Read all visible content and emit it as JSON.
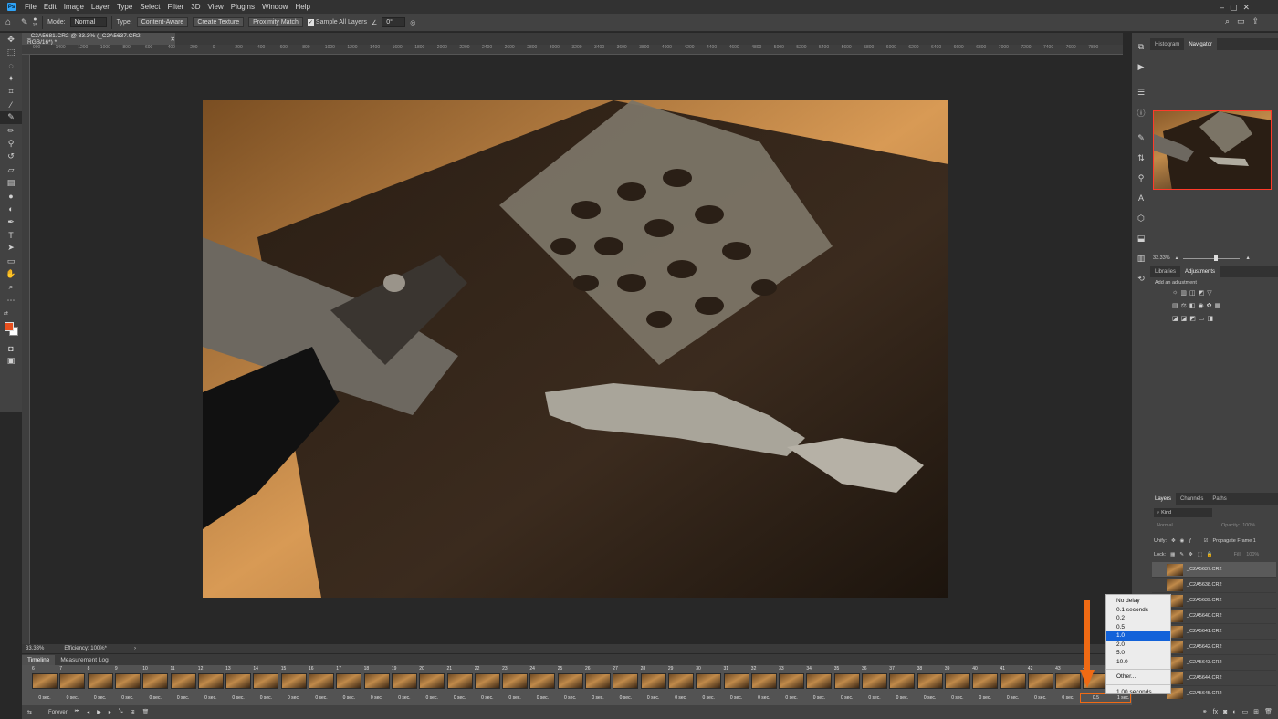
{
  "menubar": {
    "logo": "Ps",
    "items": [
      "File",
      "Edit",
      "Image",
      "Layer",
      "Type",
      "Select",
      "Filter",
      "3D",
      "View",
      "Plugins",
      "Window",
      "Help"
    ]
  },
  "options": {
    "brush_size": "15",
    "mode_label": "Mode:",
    "mode_value": "Normal",
    "type_label": "Type:",
    "type_content_aware": "Content-Aware",
    "type_create_texture": "Create Texture",
    "type_proximity": "Proximity Match",
    "sample_all": "Sample All Layers",
    "angle": "0°"
  },
  "document": {
    "tab_title": "_C2A5681.CR2 @ 33.3% (_C2A5637.CR2, RGB/16*) *",
    "zoom": "33.33%",
    "efficiency": "Efficiency: 100%*"
  },
  "ruler": {
    "h": [
      "900",
      "1400",
      "1200",
      "1000",
      "800",
      "600",
      "400",
      "200",
      "0",
      "200",
      "400",
      "600",
      "800",
      "1000",
      "1200",
      "1400",
      "1600",
      "1800",
      "2000",
      "2200",
      "2400",
      "2600",
      "2800",
      "3000",
      "3200",
      "3400",
      "3600",
      "3800",
      "4000",
      "4200",
      "4400",
      "4600",
      "4800",
      "5000",
      "5200",
      "5400",
      "5600",
      "5800",
      "6000",
      "6200",
      "6400",
      "6600",
      "6800",
      "7000",
      "7200",
      "7400",
      "7600",
      "7800"
    ]
  },
  "timeline": {
    "tabs": [
      "Timeline",
      "Measurement Log"
    ],
    "frames": [
      {
        "n": "6",
        "d": "0 sec."
      },
      {
        "n": "7",
        "d": "0 sec."
      },
      {
        "n": "8",
        "d": "0 sec."
      },
      {
        "n": "9",
        "d": "0 sec."
      },
      {
        "n": "10",
        "d": "0 sec."
      },
      {
        "n": "11",
        "d": "0 sec."
      },
      {
        "n": "12",
        "d": "0 sec."
      },
      {
        "n": "13",
        "d": "0 sec."
      },
      {
        "n": "14",
        "d": "0 sec."
      },
      {
        "n": "15",
        "d": "0 sec."
      },
      {
        "n": "16",
        "d": "0 sec."
      },
      {
        "n": "17",
        "d": "0 sec."
      },
      {
        "n": "18",
        "d": "0 sec."
      },
      {
        "n": "19",
        "d": "0 sec."
      },
      {
        "n": "20",
        "d": "0 sec."
      },
      {
        "n": "21",
        "d": "0 sec."
      },
      {
        "n": "22",
        "d": "0 sec."
      },
      {
        "n": "23",
        "d": "0 sec."
      },
      {
        "n": "24",
        "d": "0 sec."
      },
      {
        "n": "25",
        "d": "0 sec."
      },
      {
        "n": "26",
        "d": "0 sec."
      },
      {
        "n": "27",
        "d": "0 sec."
      },
      {
        "n": "28",
        "d": "0 sec."
      },
      {
        "n": "29",
        "d": "0 sec."
      },
      {
        "n": "30",
        "d": "0 sec."
      },
      {
        "n": "31",
        "d": "0 sec."
      },
      {
        "n": "32",
        "d": "0 sec."
      },
      {
        "n": "33",
        "d": "0 sec."
      },
      {
        "n": "34",
        "d": "0 sec."
      },
      {
        "n": "35",
        "d": "0 sec."
      },
      {
        "n": "36",
        "d": "0 sec."
      },
      {
        "n": "37",
        "d": "0 sec."
      },
      {
        "n": "38",
        "d": "0 sec."
      },
      {
        "n": "39",
        "d": "0 sec."
      },
      {
        "n": "40",
        "d": "0 sec."
      },
      {
        "n": "41",
        "d": "0 sec."
      },
      {
        "n": "42",
        "d": "0 sec."
      },
      {
        "n": "43",
        "d": "0 sec."
      },
      {
        "n": "44",
        "d": "0.5"
      },
      {
        "n": "45",
        "d": "1 sec."
      }
    ],
    "loop": "Forever"
  },
  "delay_menu": {
    "items": [
      "No delay",
      "0.1 seconds",
      "0.2",
      "0.5",
      "1.0",
      "2.0",
      "5.0",
      "10.0"
    ],
    "selected": "1.0",
    "other": "Other...",
    "current": "1.00 seconds"
  },
  "panels": {
    "top_tabs": [
      "Histogram",
      "Navigator"
    ],
    "nav_zoom": "33.33%",
    "adj_tabs": [
      "Libraries",
      "Adjustments"
    ],
    "adj_hint": "Add an adjustment",
    "layer_tabs": [
      "Layers",
      "Channels",
      "Paths"
    ],
    "kind": "Kind",
    "blend": "Normal",
    "opacity": "Opacity:",
    "opacity_val": "100%",
    "unify": "Unify:",
    "propagate": "Propagate Frame 1",
    "lock": "Lock:",
    "fill": "Fill:",
    "fill_val": "100%",
    "layers": [
      "_C2A5637.CR2",
      "_C2A5638.CR2",
      "_C2A5639.CR2",
      "_C2A5640.CR2",
      "_C2A5641.CR2",
      "_C2A5642.CR2",
      "_C2A5643.CR2",
      "_C2A5644.CR2",
      "_C2A5645.CR2"
    ]
  },
  "colors": {
    "accent": "#1262d9",
    "highlight": "#f06a14",
    "foreground": "#e8501e"
  }
}
